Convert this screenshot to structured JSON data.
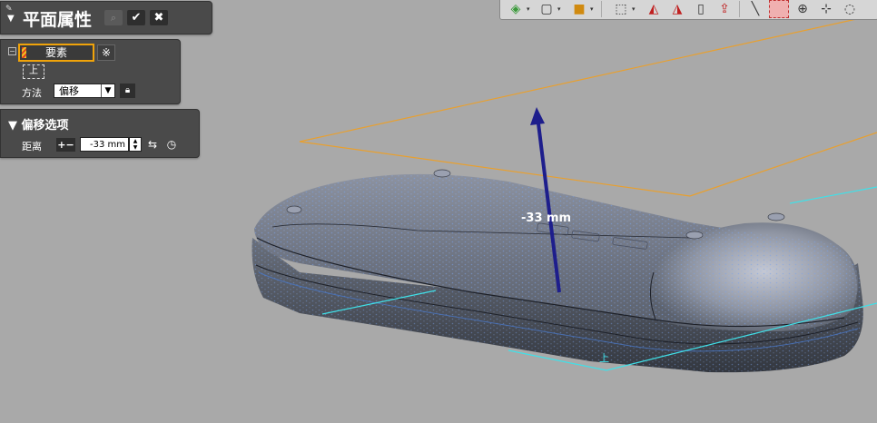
{
  "panel": {
    "title": "平面属性",
    "search_icon": "search-icon",
    "ok_icon": "✔",
    "cancel_icon": "✖"
  },
  "elements": {
    "field_label": "要素",
    "extra_icon": "※",
    "plane_ref_label": "上",
    "method_label": "方法",
    "method_value": "偏移"
  },
  "offset": {
    "section_title": "偏移选项",
    "distance_label": "距离",
    "sign_label": "+−",
    "distance_value": "-33 mm"
  },
  "viewport": {
    "dimension_label": "-33 mm",
    "plane_tag": "上",
    "colors": {
      "background": "#a9a9a9",
      "offset_plane": "#e8a030",
      "base_plane": "#40e0e8",
      "arrow": "#1e1e8c",
      "highlight": "#f0a30a"
    }
  },
  "toolbar": {
    "icons": [
      "display-mode-icon",
      "cube-view-icon",
      "color-cube-icon",
      "wireframe-cube-icon",
      "section-icon",
      "section-alt-icon",
      "parallel-planes-icon",
      "export-icon",
      "line-icon",
      "selection-box-icon",
      "point-select-icon",
      "crosshair-icon",
      "lasso-icon"
    ]
  }
}
